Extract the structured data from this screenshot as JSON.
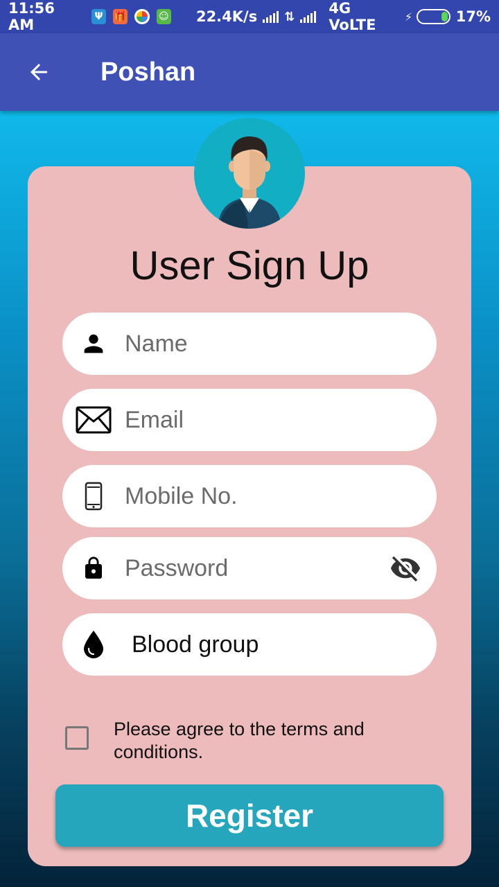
{
  "status_bar": {
    "time": "11:56 AM",
    "net_speed": "22.4K/s",
    "network": "4G VoLTE",
    "battery": "17%",
    "icons": [
      "usb-icon",
      "gift-icon",
      "photos-icon",
      "game-icon",
      "signal-icon",
      "data-arrows-icon",
      "bolt-icon",
      "battery-icon"
    ]
  },
  "app_bar": {
    "title": "Poshan",
    "back_icon": "arrow-left-icon"
  },
  "form": {
    "title": "User Sign Up",
    "name_placeholder": "Name",
    "email_placeholder": "Email",
    "mobile_placeholder": "Mobile No.",
    "password_placeholder": "Password",
    "blood_group_label": "Blood group",
    "terms_text": "Please agree to the terms and conditions.",
    "terms_checked": false,
    "register_label": "Register"
  },
  "colors": {
    "status_bar": "#3346ad",
    "app_bar": "#3f51b5",
    "card": "#edbbbb",
    "register_button": "#26a6bd",
    "avatar_bg": "#12aec4"
  }
}
